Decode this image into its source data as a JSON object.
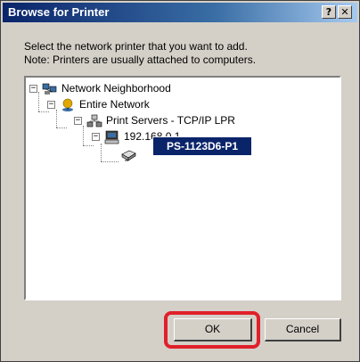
{
  "dialog": {
    "title": "Browse for Printer",
    "help_button": "?",
    "close_button": "✕",
    "instruction_line1": "Select the network printer that you want to add.",
    "instruction_line2": "Note: Printers are usually attached to computers."
  },
  "tree": {
    "items": [
      {
        "label": "Network Neighborhood",
        "expander": "−",
        "icon": "network-neighborhood-icon"
      },
      {
        "label": "Entire Network",
        "expander": "−",
        "icon": "globe-network-icon"
      },
      {
        "label": "Print Servers - TCP/IP LPR",
        "expander": "−",
        "icon": "print-server-group-icon"
      },
      {
        "label": "192.168.0.1",
        "expander": "−",
        "icon": "computer-icon"
      },
      {
        "label": "PS-1123D6-P1",
        "expander": "",
        "icon": "printer-icon",
        "selected": true
      }
    ]
  },
  "buttons": {
    "ok": "OK",
    "cancel": "Cancel"
  },
  "annotation": {
    "color": "#e0202a"
  }
}
